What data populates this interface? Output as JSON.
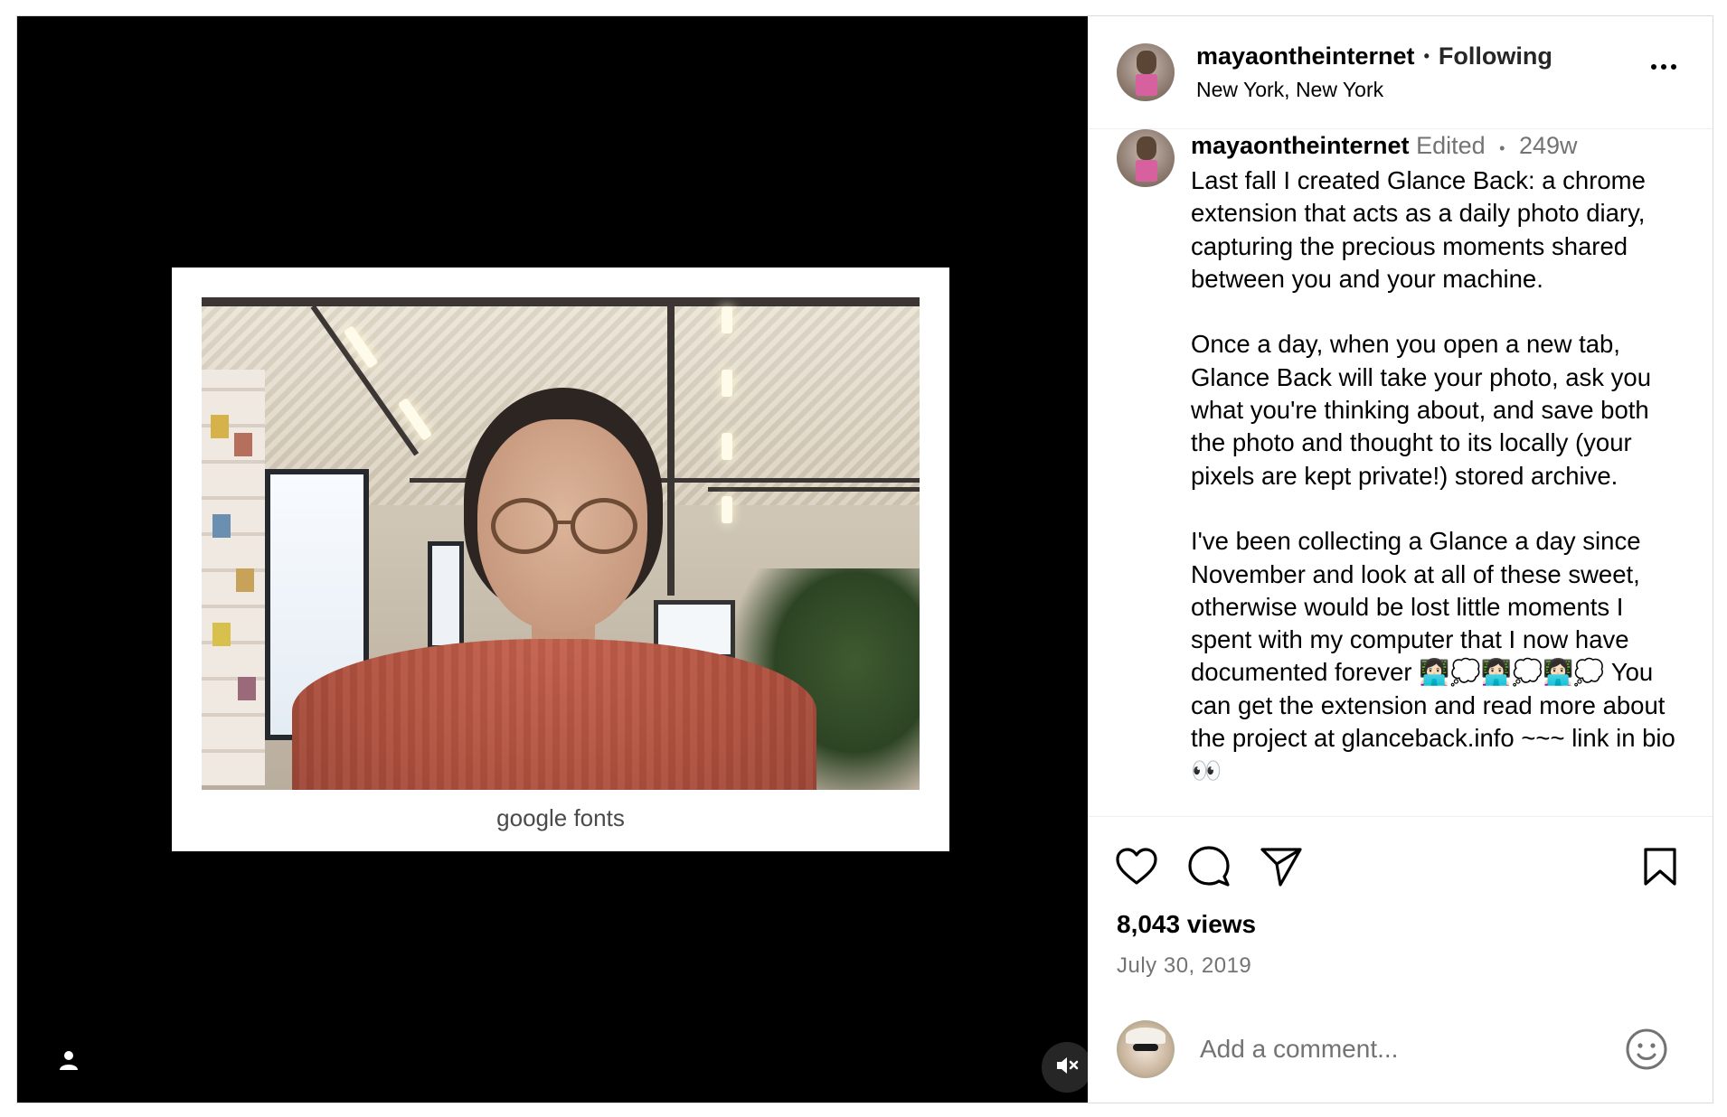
{
  "media": {
    "caption": "google fonts",
    "tag_icon": "person-icon",
    "mute_icon": "speaker-muted-icon"
  },
  "header": {
    "username": "mayaontheinternet",
    "separator": "•",
    "follow_state": "Following",
    "location": "New York, New York",
    "more_icon": "more-horizontal-icon"
  },
  "caption_comment": {
    "username": "mayaontheinternet",
    "edited": "Edited",
    "separator": "•",
    "age": "249w",
    "text": "Last fall I created Glance Back: a chrome extension that acts as a daily photo diary, capturing the precious moments shared between you and your machine.\n\nOnce a day, when you open a new tab, Glance Back will take your photo, ask you what you're thinking about, and save both the photo and thought to its locally (your pixels are kept private!) stored archive.\n\nI've been collecting a Glance a day since November and look at all of these sweet, otherwise would be lost little moments I spent with my computer that I now have documented forever 👩🏻‍💻💭👩🏻‍💻💭👩🏻‍💻💭 You can get the extension and read more about the project at glanceback.info ~~~ link in bio 👀"
  },
  "actions": {
    "like_icon": "heart-icon",
    "comment_icon": "comment-bubble-icon",
    "share_icon": "paper-plane-icon",
    "save_icon": "bookmark-icon"
  },
  "stats": {
    "views": "8,043 views",
    "date": "July 30, 2019"
  },
  "comment_box": {
    "placeholder": "Add a comment...",
    "emoji_icon": "smiley-icon"
  },
  "colors": {
    "media_bg": "#000000",
    "muted_text": "#737373",
    "border": "#dbdbdb"
  }
}
